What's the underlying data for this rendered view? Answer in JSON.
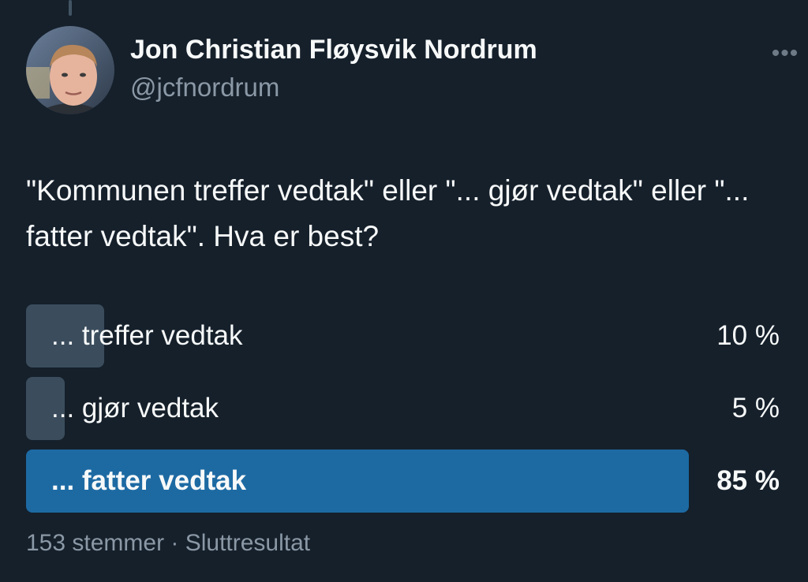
{
  "author": {
    "name": "Jon Christian Fløysvik Nordrum",
    "handle": "@jcfnordrum"
  },
  "more_icon": "ellipsis-horizontal-icon",
  "tweet": {
    "text": "\"Kommunen treffer vedtak\" eller \"... gjør vedtak\" eller \"... fatter vedtak\". Hva er best?"
  },
  "poll": {
    "options": [
      {
        "label": "... treffer vedtak",
        "percent_text": "10 %",
        "percent": 10,
        "winner": false
      },
      {
        "label": "... gjør vedtak",
        "percent_text": "5 %",
        "percent": 5,
        "winner": false
      },
      {
        "label": "... fatter vedtak",
        "percent_text": "85 %",
        "percent": 85,
        "winner": true
      }
    ],
    "footer": "153 stemmer · Sluttresultat"
  },
  "colors": {
    "background": "#15202b",
    "bar": "#3b4d5d",
    "winner_bar": "#1d6aa3",
    "secondary_text": "#8b98a5"
  }
}
